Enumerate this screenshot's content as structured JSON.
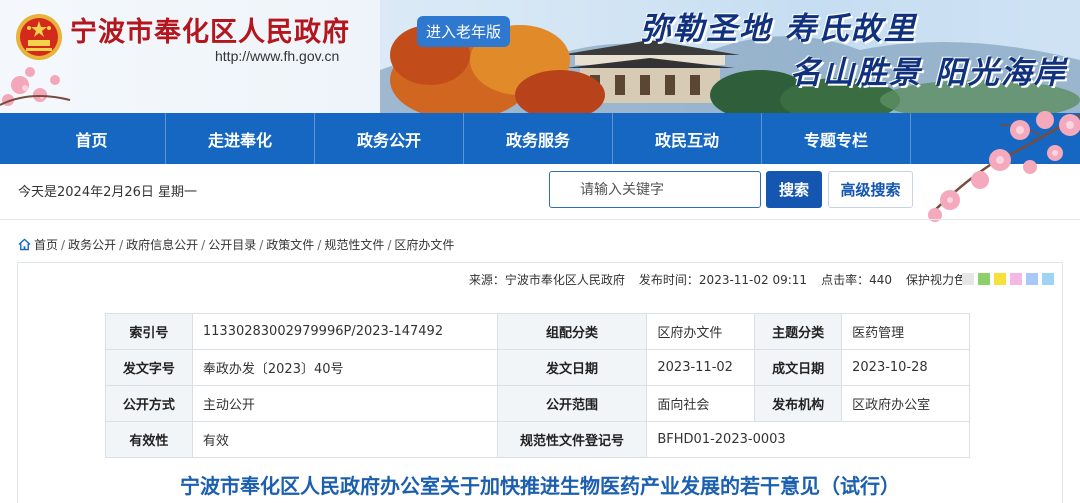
{
  "header": {
    "site_name": "宁波市奉化区人民政府",
    "site_url": "http://www.fh.gov.cn",
    "elder_mode_label": "进入老年版",
    "slogan_line1": "弥勒圣地 寿氏故里",
    "slogan_line2": "名山胜景 阳光海岸"
  },
  "nav": {
    "items": [
      {
        "label": "首页"
      },
      {
        "label": "走进奉化"
      },
      {
        "label": "政务公开"
      },
      {
        "label": "政务服务"
      },
      {
        "label": "政民互动"
      },
      {
        "label": "专题专栏"
      }
    ]
  },
  "toolbar": {
    "date_text": "今天是2024年2月26日  星期一",
    "search_placeholder": "请输入关键字",
    "search_label": "搜索",
    "advanced_search_label": "高级搜索"
  },
  "breadcrumb": {
    "items": [
      "首页",
      "政务公开",
      "政府信息公开",
      "公开目录",
      "政策文件",
      "规范性文件",
      "区府办文件"
    ]
  },
  "meta": {
    "source_label": "来源：",
    "source_value": "宁波市奉化区人民政府",
    "publish_label": "发布时间：",
    "publish_value": "2023-11-02 09:11",
    "clicks_label": "点击率：",
    "clicks_value": "440",
    "eye_label": "保护视力色：",
    "swatch_colors": [
      "#e6e6e6",
      "#8dd06a",
      "#f5e13a",
      "#f4b8e4",
      "#a8c8f8",
      "#9fd4f5"
    ]
  },
  "info_table": {
    "index_label": "索引号",
    "index_value": "11330283002979996P/2023-147492",
    "category_label": "组配分类",
    "category_value": "区府办文件",
    "topic_label": "主题分类",
    "topic_value": "医药管理",
    "docno_label": "发文字号",
    "docno_value": "奉政办发〔2023〕40号",
    "issue_date_label": "发文日期",
    "issue_date_value": "2023-11-02",
    "made_date_label": "成文日期",
    "made_date_value": "2023-10-28",
    "open_mode_label": "公开方式",
    "open_mode_value": "主动公开",
    "scope_label": "公开范围",
    "scope_value": "面向社会",
    "org_label": "发布机构",
    "org_value": "区政府办公室",
    "validity_label": "有效性",
    "validity_value": "有效",
    "regno_label": "规范性文件登记号",
    "regno_value": "BFHD01-2023-0003"
  },
  "document": {
    "title": "宁波市奉化区人民政府办公室关于加快推进生物医药产业发展的若干意见（试行）"
  }
}
